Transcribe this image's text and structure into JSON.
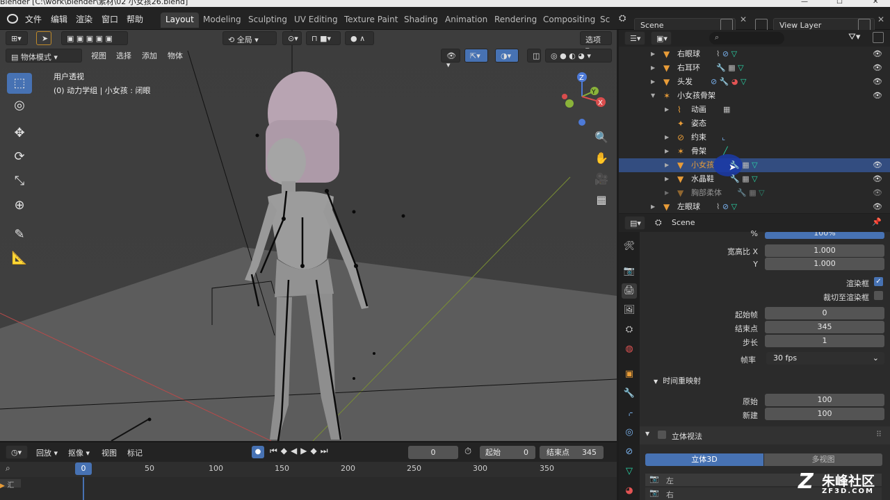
{
  "window": {
    "title": "Blender [C:\\work\\blender\\素材\\02 小女孩26.blend]",
    "minimize": "—",
    "maximize": "☐",
    "close": "✕"
  },
  "menus": [
    "文件",
    "编辑",
    "渲染",
    "窗口",
    "帮助"
  ],
  "workspaces": [
    {
      "label": "Layout",
      "active": true
    },
    {
      "label": "Modeling",
      "active": false
    },
    {
      "label": "Sculpting",
      "active": false
    },
    {
      "label": "UV Editing",
      "active": false
    },
    {
      "label": "Texture Paint",
      "active": false
    },
    {
      "label": "Shading",
      "active": false
    },
    {
      "label": "Animation",
      "active": false
    },
    {
      "label": "Rendering",
      "active": false
    },
    {
      "label": "Compositing",
      "active": false
    },
    {
      "label": "Sc",
      "active": false
    }
  ],
  "scene": {
    "label": "Scene"
  },
  "view_layer": {
    "label": "View Layer"
  },
  "viewport": {
    "orientation": "全局",
    "options_label": "选项",
    "mode": "物体模式",
    "menus": [
      "视图",
      "选择",
      "添加",
      "物体"
    ],
    "info_line1": "用户透视",
    "info_line2": "(0) 动力学组 | 小女孩 : 闭眼",
    "gizmo": {
      "z": "Z",
      "y": "Y",
      "x": "X"
    }
  },
  "timeline": {
    "menus": [
      "回放",
      "抠像",
      "视图",
      "标记"
    ],
    "current_frame": "0",
    "start_label": "起始",
    "start_value": "0",
    "end_label": "结束点",
    "end_value": "345",
    "ticks": [
      "0",
      "50",
      "100",
      "150",
      "200",
      "250",
      "300",
      "350"
    ],
    "track_label": "汇"
  },
  "outliner": {
    "search_placeholder": "",
    "rows": [
      {
        "name": "右眼球",
        "indent": 0,
        "selected": false
      },
      {
        "name": "右耳环",
        "indent": 0,
        "selected": false
      },
      {
        "name": "头发",
        "indent": 0,
        "selected": false
      },
      {
        "name": "小女孩骨架",
        "indent": 0,
        "selected": false
      },
      {
        "name": "动画",
        "indent": 1,
        "selected": false
      },
      {
        "name": "姿态",
        "indent": 1,
        "selected": false
      },
      {
        "name": "约束",
        "indent": 1,
        "selected": false
      },
      {
        "name": "骨架",
        "indent": 1,
        "selected": false
      },
      {
        "name": "小女孩",
        "indent": 1,
        "selected": true
      },
      {
        "name": "水晶鞋",
        "indent": 1,
        "selected": false
      },
      {
        "name": "胸部柔体",
        "indent": 1,
        "selected": false
      },
      {
        "name": "左眼球",
        "indent": 0,
        "selected": false
      }
    ]
  },
  "properties": {
    "context": "Scene",
    "percent_value": "100%",
    "aspect_x_label": "宽高比 X",
    "aspect_x_value": "1.000",
    "aspect_y_label": "Y",
    "aspect_y_value": "1.000",
    "render_region_label": "渲染框",
    "crop_label": "裁切至渲染框",
    "frame_start_label": "起始帧",
    "frame_start_value": "0",
    "frame_end_label": "结束点",
    "frame_end_value": "345",
    "step_label": "步长",
    "step_value": "1",
    "fps_label": "帧率",
    "fps_value": "30 fps",
    "remap_label": "时间重映射",
    "old_label": "原始",
    "old_value": "100",
    "new_label": "新建",
    "new_value": "100",
    "stereo_label": "立体视法",
    "stereo_3d": "立体3D",
    "multiview": "多视图",
    "view_left": "左",
    "view_right": "右"
  },
  "watermark": {
    "brand": "朱峰社区",
    "url": "ZF3D.COM"
  },
  "colors": {
    "accent": "#4772b3",
    "selection": "#334d80",
    "object_orange": "#e89c38"
  }
}
